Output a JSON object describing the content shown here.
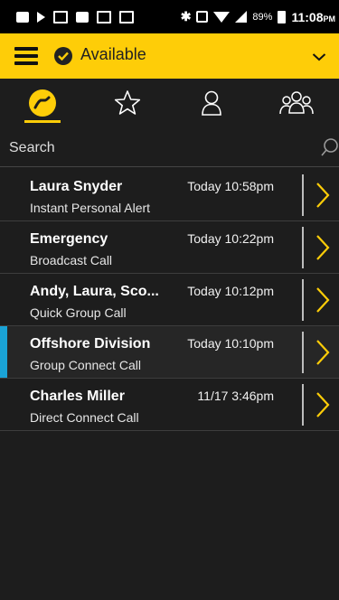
{
  "status_bar": {
    "battery": "89%",
    "time": "11:08",
    "ampm": "PM"
  },
  "header": {
    "status_label": "Available"
  },
  "tabs": [
    {
      "name": "recent-calls",
      "icon": "phone-icon",
      "active": true
    },
    {
      "name": "favorites",
      "icon": "star-icon",
      "active": false
    },
    {
      "name": "contacts",
      "icon": "person-icon",
      "active": false
    },
    {
      "name": "groups",
      "icon": "group-icon",
      "active": false
    }
  ],
  "search": {
    "placeholder": "Search"
  },
  "calls": [
    {
      "name": "Laura Snyder",
      "time": "Today 10:58pm",
      "type": "Instant Personal Alert"
    },
    {
      "name": "Emergency",
      "time": "Today 10:22pm",
      "type": "Broadcast Call"
    },
    {
      "name": "Andy, Laura, Sco...",
      "time": "Today 10:12pm",
      "type": "Quick Group Call"
    },
    {
      "name": "Offshore Division",
      "time": "Today 10:10pm",
      "type": "Group Connect Call"
    },
    {
      "name": "Charles Miller",
      "time": "11/17 3:46pm",
      "type": "Direct Connect Call"
    }
  ],
  "colors": {
    "accent": "#fecd08",
    "highlight": "#1aa3d6",
    "background": "#1d1d1d"
  }
}
